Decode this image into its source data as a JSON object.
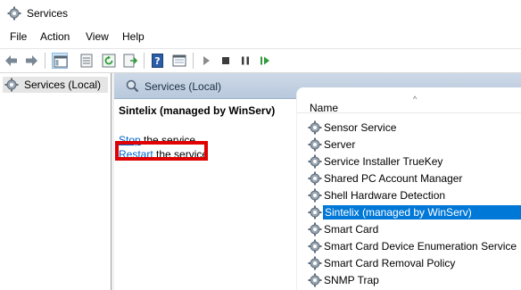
{
  "window": {
    "title": "Services",
    "icon": "gear-icon"
  },
  "menu": {
    "items": [
      "File",
      "Action",
      "View",
      "Help"
    ]
  },
  "toolbar": {
    "buttons": [
      "back-arrow-icon",
      "forward-arrow-icon",
      "console-tree-icon",
      "properties-icon",
      "refresh-icon",
      "export-list-icon",
      "help-icon",
      "description-icon",
      "start-icon",
      "stop-icon",
      "pause-icon",
      "resume-icon"
    ]
  },
  "tree": {
    "root_label": "Services (Local)"
  },
  "pane": {
    "header_title": "Services (Local)"
  },
  "details": {
    "service_name": "Sintelix (managed by WinServ)",
    "stop_link": "Stop",
    "stop_rest": " the service",
    "restart_link": "Restart",
    "restart_rest": " the service"
  },
  "list": {
    "column_name": "Name",
    "sort_indicator": "^",
    "rows": [
      "Sensor Service",
      "Server",
      "Service Installer TrueKey",
      "Shared PC Account Manager",
      "Shell Hardware Detection",
      "Sintelix (managed by WinServ)",
      "Smart Card",
      "Smart Card Device Enumeration Service",
      "Smart Card Removal Policy",
      "SNMP Trap"
    ],
    "selected_row": "Sintelix (managed by WinServ)"
  },
  "colors": {
    "selection": "#0078d7",
    "link": "#0066cc",
    "highlight_box": "#e00000"
  }
}
